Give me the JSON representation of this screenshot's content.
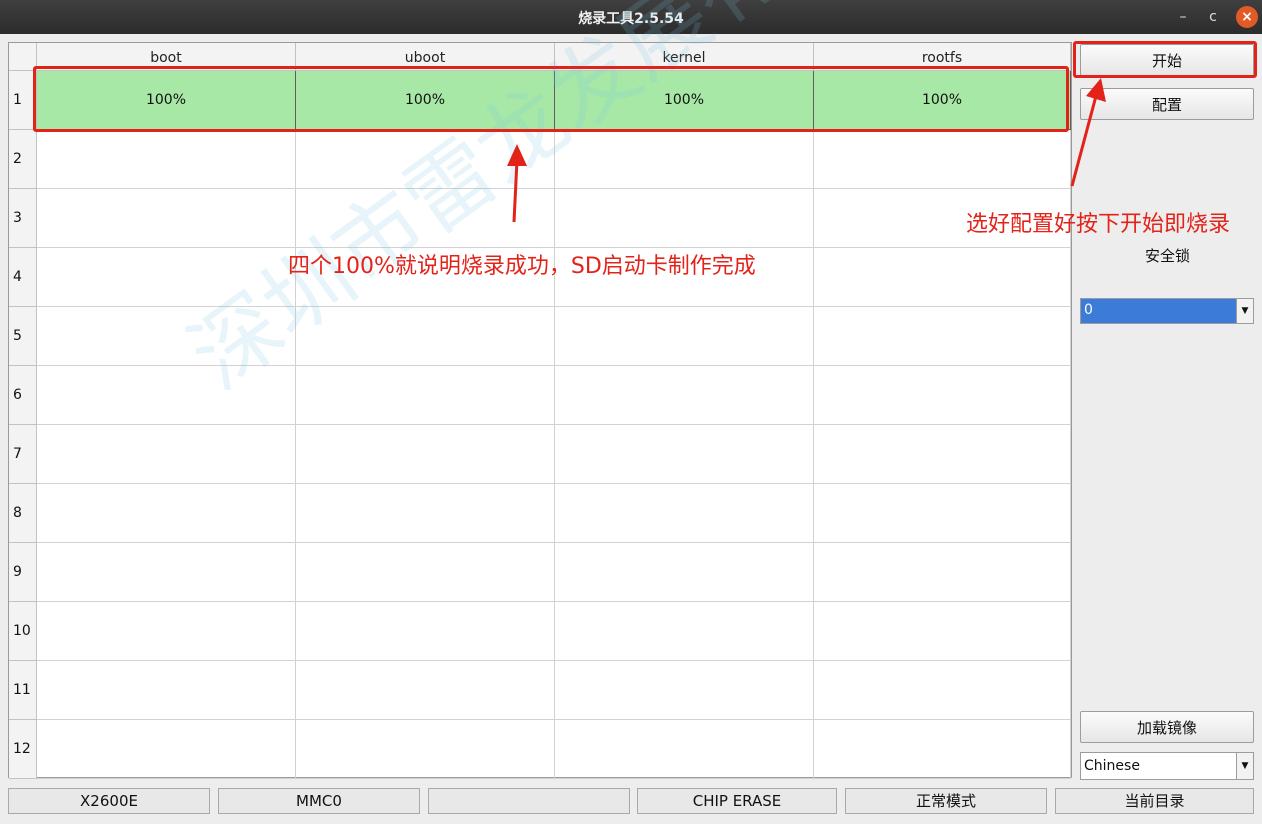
{
  "window": {
    "title": "烧录工具2.5.54",
    "controls": {
      "minimize": "–",
      "maximize": "c",
      "close": "×"
    }
  },
  "table": {
    "columns": [
      "boot",
      "uboot",
      "kernel",
      "rootfs"
    ],
    "rows": [
      {
        "index": "1",
        "cells": [
          "100%",
          "100%",
          "100%",
          "100%"
        ]
      },
      {
        "index": "2",
        "cells": [
          "",
          "",
          "",
          ""
        ]
      },
      {
        "index": "3",
        "cells": [
          "",
          "",
          "",
          ""
        ]
      },
      {
        "index": "4",
        "cells": [
          "",
          "",
          "",
          ""
        ]
      },
      {
        "index": "5",
        "cells": [
          "",
          "",
          "",
          ""
        ]
      },
      {
        "index": "6",
        "cells": [
          "",
          "",
          "",
          ""
        ]
      },
      {
        "index": "7",
        "cells": [
          "",
          "",
          "",
          ""
        ]
      },
      {
        "index": "8",
        "cells": [
          "",
          "",
          "",
          ""
        ]
      },
      {
        "index": "9",
        "cells": [
          "",
          "",
          "",
          ""
        ]
      },
      {
        "index": "10",
        "cells": [
          "",
          "",
          "",
          ""
        ]
      },
      {
        "index": "11",
        "cells": [
          "",
          "",
          "",
          ""
        ]
      },
      {
        "index": "12",
        "cells": [
          "",
          "",
          "",
          ""
        ]
      }
    ],
    "progress_fill_color": "#a7e8a6"
  },
  "side": {
    "start_label": "开始",
    "config_label": "配置",
    "safety_lock_label": "安全锁",
    "safety_lock_value": "0",
    "load_image_label": "加载镜像",
    "language_value": "Chinese"
  },
  "status": [
    "X2600E",
    "MMC0",
    "",
    "CHIP ERASE",
    "正常模式",
    "当前目录"
  ],
  "annotations": {
    "start_hint": "选好配置好按下开始即烧录",
    "success_hint": "四个100%就说明烧录成功，SD启动卡制作完成",
    "color": "#e3231a"
  },
  "watermark": "深圳市雷龙发展有限公司"
}
